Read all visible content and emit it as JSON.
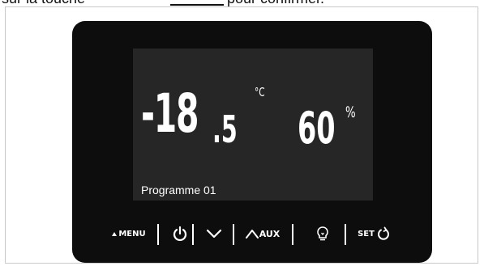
{
  "caption": {
    "before": "sur la touche",
    "after": "pour confirmer."
  },
  "display": {
    "temperature_integer": "-18",
    "temperature_decimal": ".5",
    "temperature_unit": "°C",
    "humidity_value": "60",
    "humidity_unit": "%",
    "program_label": "Programme 01"
  },
  "buttons": {
    "menu_label": "MENU",
    "aux_label": "AUX",
    "set_label": "SET"
  },
  "icons": [
    "triangle-up-icon",
    "power-icon",
    "chevron-down-icon",
    "chevron-up-icon",
    "bulb-icon",
    "refresh-icon"
  ],
  "colors": {
    "device_body": "#0d0d0d",
    "screen": "#262626",
    "text": "#ffffff"
  }
}
